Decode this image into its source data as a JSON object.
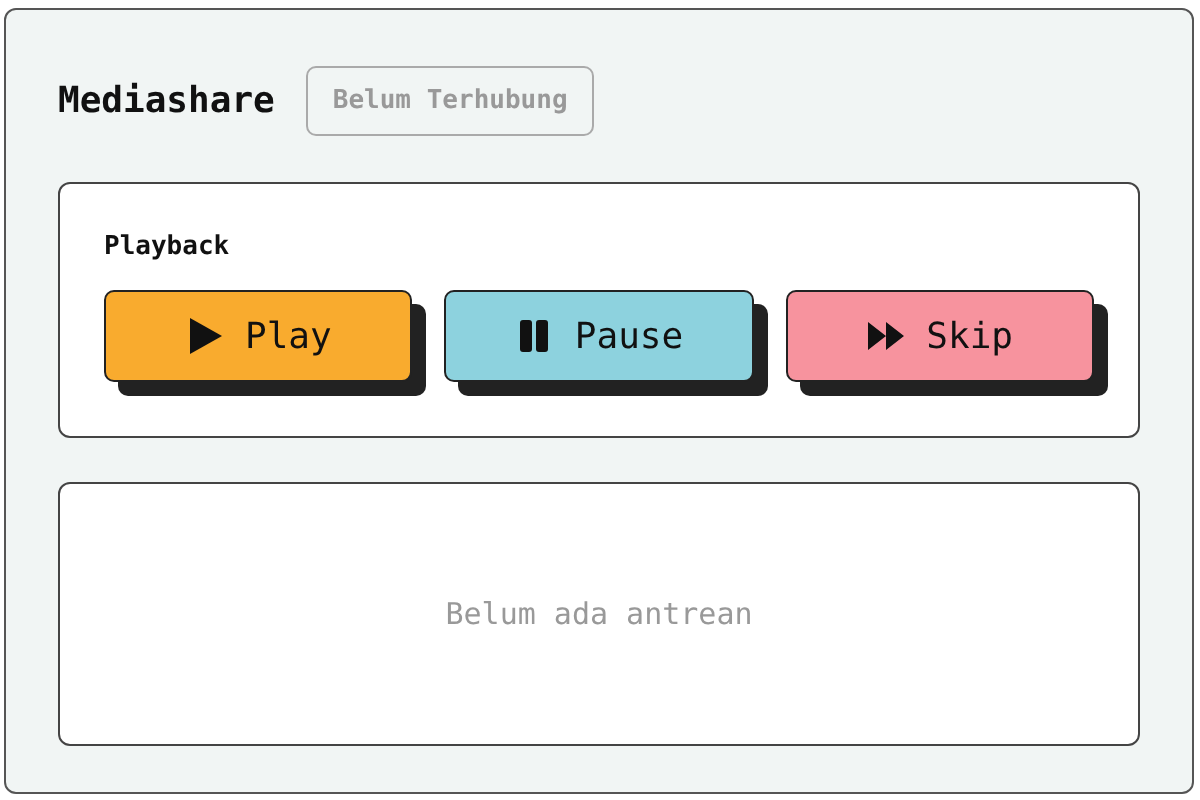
{
  "title": "Mediashare",
  "status_badge": "Belum Terhubung",
  "playback": {
    "heading": "Playback",
    "buttons": [
      {
        "kind": "play",
        "label": "Play",
        "color": "#f9ab2e"
      },
      {
        "kind": "pause",
        "label": "Pause",
        "color": "#8dd2de"
      },
      {
        "kind": "skip",
        "label": "Skip",
        "color": "#f7939e"
      }
    ]
  },
  "queue": {
    "empty_message": "Belum ada antrean"
  }
}
